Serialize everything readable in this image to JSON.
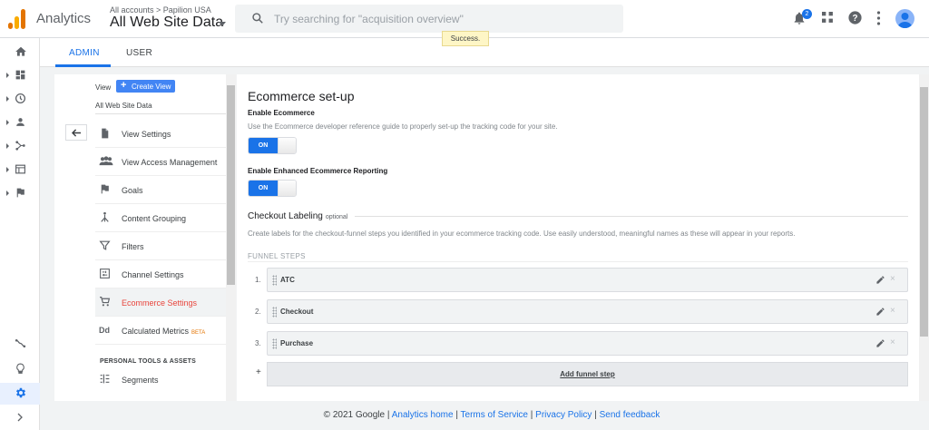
{
  "header": {
    "app_name": "Analytics",
    "account_crumb": "All accounts > Papilion USA",
    "account_name": "All Web Site Data",
    "search_placeholder": "Try searching for \"acquisition overview\"",
    "toast": "Success.",
    "notification_count": "2"
  },
  "tabs": {
    "admin": "ADMIN",
    "user": "USER"
  },
  "admin": {
    "view_label": "View",
    "create_view": "Create View",
    "view_name": "All Web Site Data",
    "items": [
      {
        "label": "View Settings"
      },
      {
        "label": "View Access Management"
      },
      {
        "label": "Goals"
      },
      {
        "label": "Content Grouping"
      },
      {
        "label": "Filters"
      },
      {
        "label": "Channel Settings"
      },
      {
        "label": "Ecommerce Settings"
      },
      {
        "label": "Calculated Metrics",
        "badge": "BETA"
      }
    ],
    "section": "PERSONAL TOOLS & ASSETS",
    "segments": "Segments"
  },
  "main": {
    "title": "Ecommerce set-up",
    "enable_label": "Enable Ecommerce",
    "enable_help": "Use the Ecommerce developer reference guide to properly set-up the tracking code for your site.",
    "toggle_on": "ON",
    "enhanced_label": "Enable Enhanced Ecommerce Reporting",
    "checkout_title": "Checkout Labeling",
    "checkout_optional": "optional",
    "checkout_help": "Create labels for the checkout-funnel steps you identified in your ecommerce tracking code. Use easily understood, meaningful names as these will appear in your reports.",
    "funnel_header": "FUNNEL STEPS",
    "steps": [
      {
        "num": "1.",
        "name": "ATC"
      },
      {
        "num": "2.",
        "name": "Checkout"
      },
      {
        "num": "3.",
        "name": "Purchase"
      }
    ],
    "add_plus": "+",
    "add_step": "Add funnel step"
  },
  "footer": {
    "copyright": "© 2021 Google",
    "home": "Analytics home",
    "terms": "Terms of Service",
    "privacy": "Privacy Policy",
    "feedback": "Send feedback",
    "sep": "|"
  },
  "colors": {
    "accent": "#1a73e8",
    "active_item": "#e8453c"
  }
}
